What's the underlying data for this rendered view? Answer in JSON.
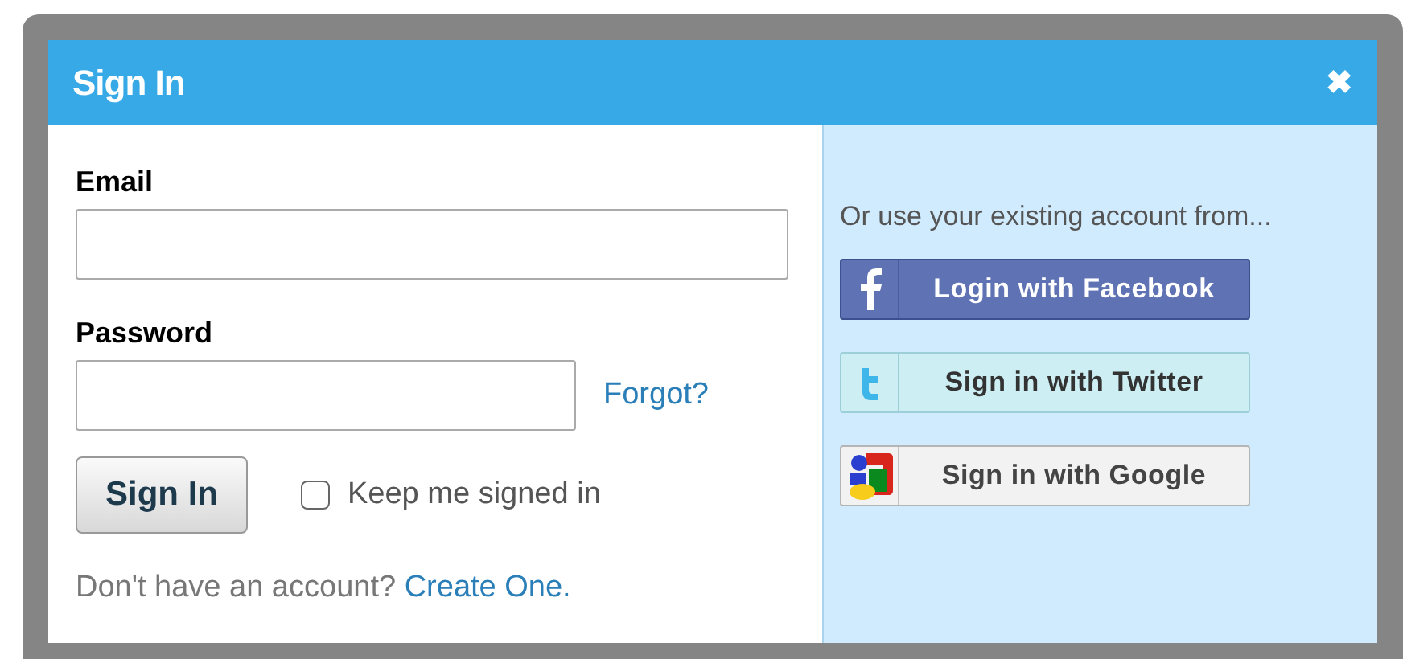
{
  "dialog": {
    "title": "Sign In",
    "close": "✖"
  },
  "form": {
    "email_label": "Email",
    "password_label": "Password",
    "forgot": "Forgot?",
    "submit": "Sign In",
    "keep_signed_in": {
      "label": "Keep me signed in",
      "checked": false
    },
    "signup_prompt": "Don't have an account?",
    "signup_link": "Create One."
  },
  "social": {
    "prompt": "Or use your existing account from...",
    "buttons": [
      {
        "kind": "facebook",
        "label": "Login with Facebook"
      },
      {
        "kind": "twitter",
        "label": "Sign in with Twitter"
      },
      {
        "kind": "google",
        "label": "Sign in with Google"
      }
    ]
  }
}
